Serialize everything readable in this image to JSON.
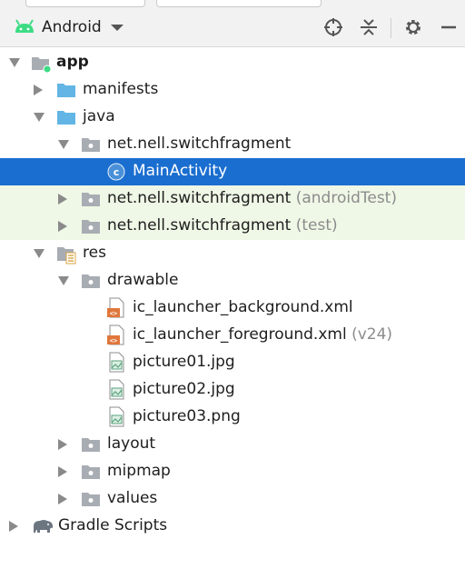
{
  "toolbar": {
    "view_label": "Android"
  },
  "tree": {
    "app": "app",
    "manifests": "manifests",
    "java": "java",
    "pkg_main": "net.nell.switchfragment",
    "main_activity": "MainActivity",
    "pkg_android_test": "net.nell.switchfragment",
    "pkg_android_test_suffix": "(androidTest)",
    "pkg_test": "net.nell.switchfragment",
    "pkg_test_suffix": "(test)",
    "res": "res",
    "drawable": "drawable",
    "file_bg": "ic_launcher_background.xml",
    "file_fg": "ic_launcher_foreground.xml",
    "file_fg_suffix": "(v24)",
    "pic1": "picture01.jpg",
    "pic2": "picture02.jpg",
    "pic3": "picture03.png",
    "layout": "layout",
    "mipmap": "mipmap",
    "values": "values",
    "gradle": "Gradle Scripts"
  },
  "colors": {
    "selection": "#1a6ed0",
    "test_background": "#eff7e6",
    "folder_blue": "#62b5e5",
    "folder_gray": "#a8adb3",
    "android_green": "#3ddc84",
    "suffix_gray": "#8c8c8c"
  }
}
